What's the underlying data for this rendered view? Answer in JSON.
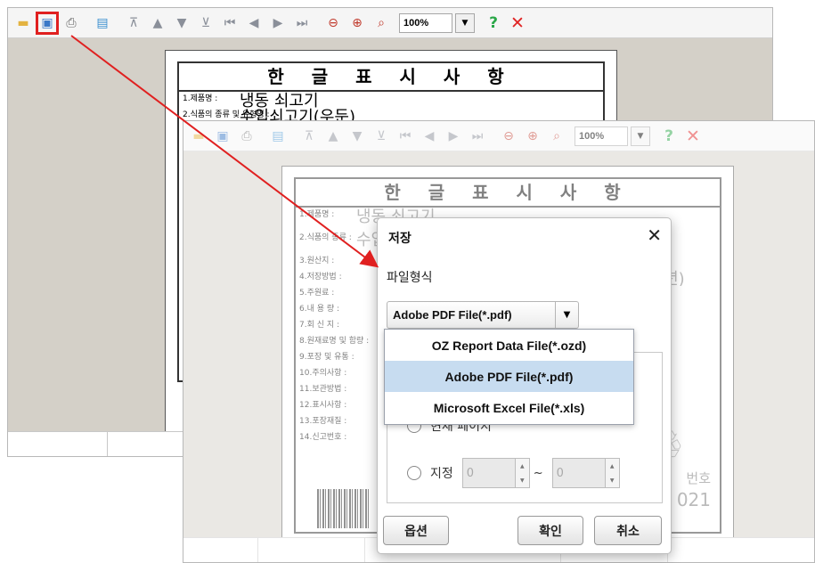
{
  "toolbar": {
    "zoom": "100%",
    "icons": [
      "folder-icon",
      "save-icon",
      "print-icon",
      "export-icon",
      "first-page-icon",
      "prev-icon",
      "next-icon",
      "last-page-icon",
      "first-nav-icon",
      "prev-nav-icon",
      "next-nav-icon",
      "last-nav-icon",
      "zoom-out-icon",
      "zoom-in-icon",
      "zoom-fit-icon",
      "help-icon",
      "close-icon"
    ]
  },
  "document": {
    "title": "한 글 표 시 사 항",
    "back_rows": [
      {
        "label": "1.제품명 :",
        "value": "냉동 쇠고기"
      },
      {
        "label": "2.식품의 종류 및 유형명 :",
        "value": "수입쇠고기(우둔)"
      }
    ],
    "front_rows": [
      {
        "label": "1.제품명 :",
        "value": "냉동 쇠고기"
      },
      {
        "label": "2.식품의 종류 :",
        "value": "수입쇠고기(우둔)"
      },
      {
        "label": "3.원산지 :",
        "value": ""
      },
      {
        "label": "4.저장방법 :",
        "value": "(/년)"
      },
      {
        "label": "5.주원료 :",
        "value": ""
      },
      {
        "label": "6.내 용 량 :",
        "value": ""
      },
      {
        "label": "7.회 신 지 :",
        "value": ""
      },
      {
        "label": "8.원재료명 및 함량 :",
        "value": ""
      },
      {
        "label": "9.포장 및 유통 :",
        "value": ""
      },
      {
        "label": "10.주의사항 :",
        "value": ""
      },
      {
        "label": "11.보관방법 :",
        "value": ""
      },
      {
        "label": "12.표시사항 :",
        "value": ""
      },
      {
        "label": "13.포장재질 :",
        "value": ""
      },
      {
        "label": "14.신고번호 :",
        "value": ""
      }
    ],
    "right_text": [
      "번호",
      "021"
    ]
  },
  "dialog": {
    "title": "저장",
    "close": "✕",
    "format_label": "파일형식",
    "selected_format": "Adobe PDF File(*.pdf)",
    "formats": [
      "OZ Report Data File(*.ozd)",
      "Adobe PDF File(*.pdf)",
      "Microsoft Excel File(*.xls)"
    ],
    "radio_current": "현재 페이지",
    "radio_range": "지정",
    "range_from": "0",
    "range_to": "0",
    "range_sep": "~",
    "buttons": {
      "options": "옵션",
      "ok": "확인",
      "cancel": "취소"
    }
  },
  "colors": {
    "highlight": "#e02020",
    "dropdown_selected": "#c7dcf0"
  }
}
